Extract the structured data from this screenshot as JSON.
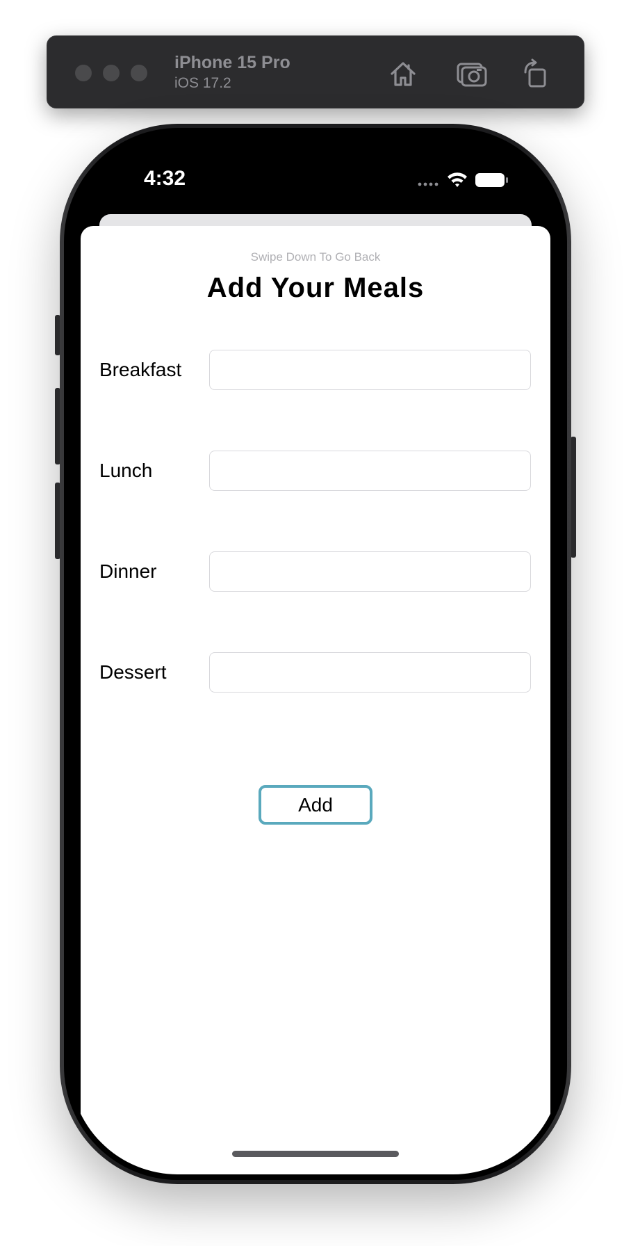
{
  "simulator": {
    "device_name": "iPhone 15 Pro",
    "os_version": "iOS 17.2",
    "icons": [
      "home-icon",
      "screenshot-icon",
      "rotate-icon"
    ]
  },
  "status_bar": {
    "time": "4:32",
    "icons": [
      "signal-dots-icon",
      "wifi-icon",
      "battery-icon"
    ]
  },
  "sheet": {
    "hint": "Swipe Down To Go Back",
    "title": "Add Your Meals",
    "rows": [
      {
        "label": "Breakfast",
        "value": "",
        "placeholder": ""
      },
      {
        "label": "Lunch",
        "value": "",
        "placeholder": ""
      },
      {
        "label": "Dinner",
        "value": "",
        "placeholder": ""
      },
      {
        "label": "Dessert",
        "value": "",
        "placeholder": ""
      }
    ],
    "add_label": "Add"
  },
  "colors": {
    "accent_border": "#5aa9bd",
    "toolbar_bg": "#2c2c2e"
  }
}
